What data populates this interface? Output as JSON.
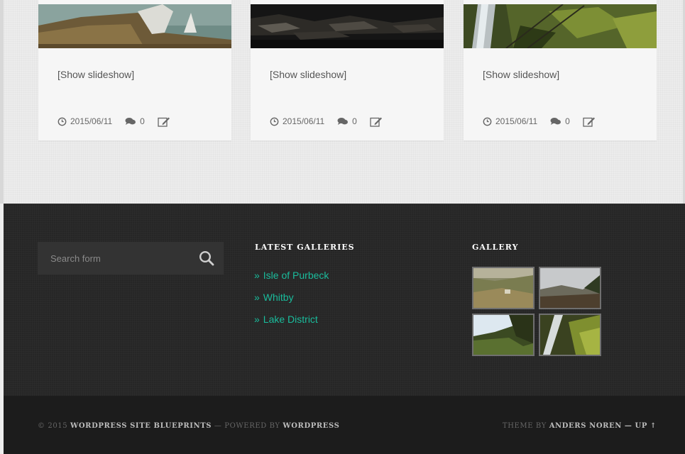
{
  "posts": [
    {
      "link_text": "[Show slideshow]",
      "date": "2015/06/11",
      "comments": "0"
    },
    {
      "link_text": "[Show slideshow]",
      "date": "2015/06/11",
      "comments": "0"
    },
    {
      "link_text": "[Show slideshow]",
      "date": "2015/06/11",
      "comments": "0"
    }
  ],
  "footer": {
    "search": {
      "placeholder": "Search form"
    },
    "latest_galleries": {
      "title": "LATEST GALLERIES",
      "arrow": "»",
      "items": [
        "Isle of Purbeck",
        "Whitby",
        "Lake District"
      ]
    },
    "gallery": {
      "title": "GALLERY"
    }
  },
  "credits": {
    "copyright": "© 2015",
    "site_name": "WORDPRESS SITE BLUEPRINTS",
    "powered_by": "— POWERED BY",
    "platform": "WORDPRESS",
    "theme_by": "THEME BY",
    "author": "ANDERS NOREN",
    "up": "— UP ↑"
  },
  "colors": {
    "accent_link": "#1abc9c",
    "footer_bg": "#262626",
    "bottom_bar_bg": "#1c1c1c"
  }
}
